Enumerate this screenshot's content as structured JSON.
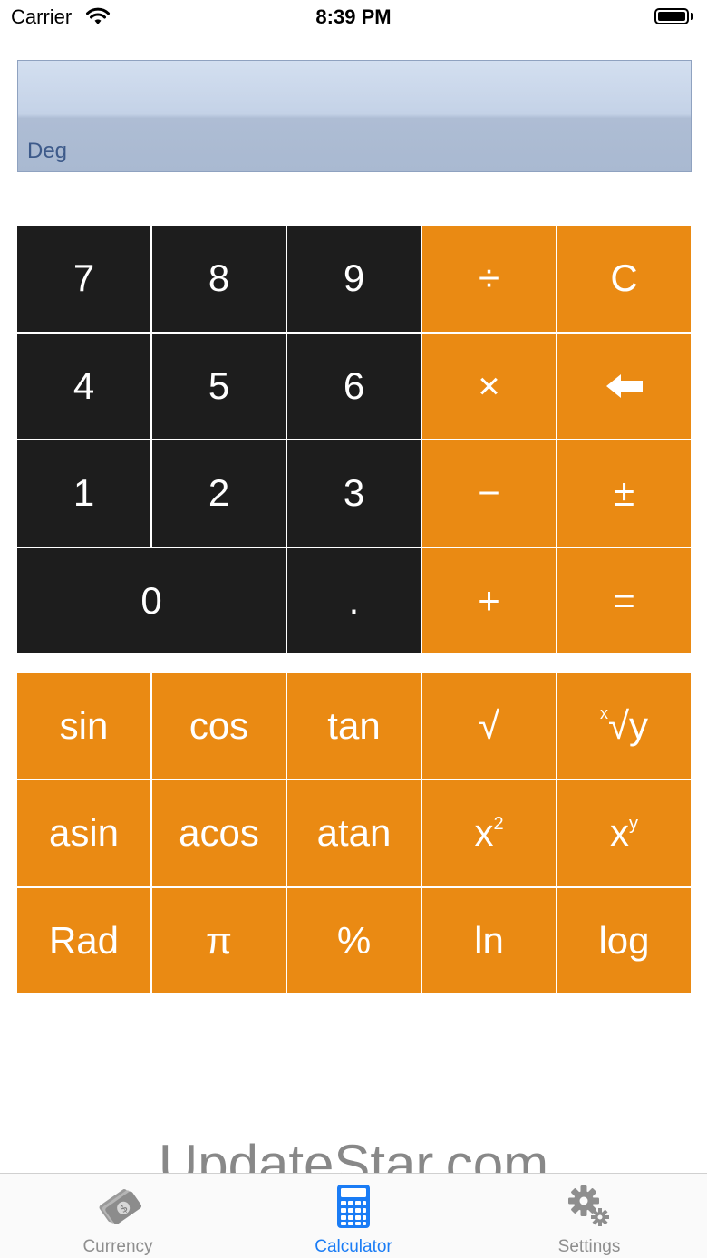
{
  "status_bar": {
    "carrier": "Carrier",
    "time": "8:39 PM"
  },
  "display": {
    "value": "",
    "angle_mode": "Deg"
  },
  "main_keys": [
    {
      "label": "7",
      "style": "dark",
      "name": "key-7"
    },
    {
      "label": "8",
      "style": "dark",
      "name": "key-8"
    },
    {
      "label": "9",
      "style": "dark",
      "name": "key-9"
    },
    {
      "label": "÷",
      "style": "orange",
      "name": "divide-button"
    },
    {
      "label": "C",
      "style": "orange",
      "name": "clear-button"
    },
    {
      "label": "4",
      "style": "dark",
      "name": "key-4"
    },
    {
      "label": "5",
      "style": "dark",
      "name": "key-5"
    },
    {
      "label": "6",
      "style": "dark",
      "name": "key-6"
    },
    {
      "label": "×",
      "style": "orange",
      "name": "multiply-button"
    },
    {
      "label": "",
      "style": "orange",
      "name": "backspace-button",
      "icon": "backspace-arrow-icon"
    },
    {
      "label": "1",
      "style": "dark",
      "name": "key-1"
    },
    {
      "label": "2",
      "style": "dark",
      "name": "key-2"
    },
    {
      "label": "3",
      "style": "dark",
      "name": "key-3"
    },
    {
      "label": "−",
      "style": "orange",
      "name": "subtract-button"
    },
    {
      "label": "±",
      "style": "orange",
      "name": "negate-button"
    },
    {
      "label": "0",
      "style": "dark",
      "name": "key-0",
      "span": 2
    },
    {
      "label": ".",
      "style": "dark",
      "name": "decimal-button"
    },
    {
      "label": "+",
      "style": "orange",
      "name": "add-button"
    },
    {
      "label": "=",
      "style": "orange",
      "name": "equals-button"
    }
  ],
  "sci_keys": [
    {
      "label": "sin",
      "name": "sin-button"
    },
    {
      "label": "cos",
      "name": "cos-button"
    },
    {
      "label": "tan",
      "name": "tan-button"
    },
    {
      "label": "√",
      "name": "sqrt-button"
    },
    {
      "label": "√y",
      "presup": "x",
      "name": "nth-root-button"
    },
    {
      "label": "asin",
      "name": "asin-button"
    },
    {
      "label": "acos",
      "name": "acos-button"
    },
    {
      "label": "atan",
      "name": "atan-button"
    },
    {
      "label": "x",
      "sup": "2",
      "name": "square-button"
    },
    {
      "label": "x",
      "sup": "y",
      "name": "power-button"
    },
    {
      "label": "Rad",
      "name": "rad-toggle-button"
    },
    {
      "label": "π",
      "name": "pi-button"
    },
    {
      "label": "%",
      "name": "percent-button"
    },
    {
      "label": "ln",
      "name": "ln-button"
    },
    {
      "label": "log",
      "name": "log-button"
    }
  ],
  "tab_bar": {
    "tabs": [
      {
        "label": "Currency",
        "icon": "currency-money-icon",
        "active": false
      },
      {
        "label": "Calculator",
        "icon": "calculator-icon",
        "active": true
      },
      {
        "label": "Settings",
        "icon": "gear-icon",
        "active": false
      }
    ],
    "active_color": "#1a7cf5",
    "inactive_color": "#8e8e8e"
  },
  "watermark": "UpdateStar.com",
  "colors": {
    "orange": "#ea8a13",
    "dark_key": "#1d1d1d"
  }
}
